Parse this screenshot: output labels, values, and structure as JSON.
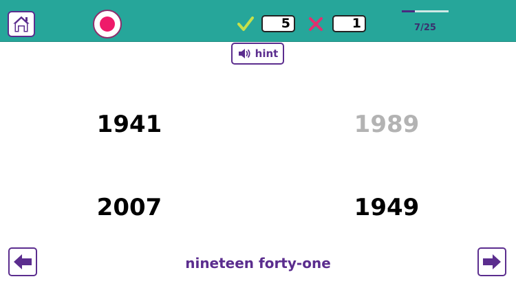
{
  "header": {
    "home_icon": "home-icon",
    "record_icon": "record-icon",
    "correct_icon": "check-icon",
    "wrong_icon": "x-icon",
    "correct_count": "5",
    "wrong_count": "1",
    "progress_text": "7/25",
    "progress_value": 0.28
  },
  "hint": {
    "label": "hint",
    "icon": "speaker-icon"
  },
  "choices": [
    {
      "year": "1941",
      "state": "default"
    },
    {
      "year": "1989",
      "state": "dimmed"
    },
    {
      "year": "2007",
      "state": "default"
    },
    {
      "year": "1949",
      "state": "default"
    }
  ],
  "footer": {
    "prompt": "nineteen forty-one",
    "prev_icon": "arrow-left-icon",
    "next_icon": "arrow-right-icon"
  },
  "colors": {
    "header_bg": "#26a69a",
    "accent_purple": "#5b2d8e",
    "record_pink": "#ee1a6a",
    "check_green": "#c6e04a",
    "x_pink": "#e0306f",
    "dimmed_text": "#b3b3b3"
  }
}
